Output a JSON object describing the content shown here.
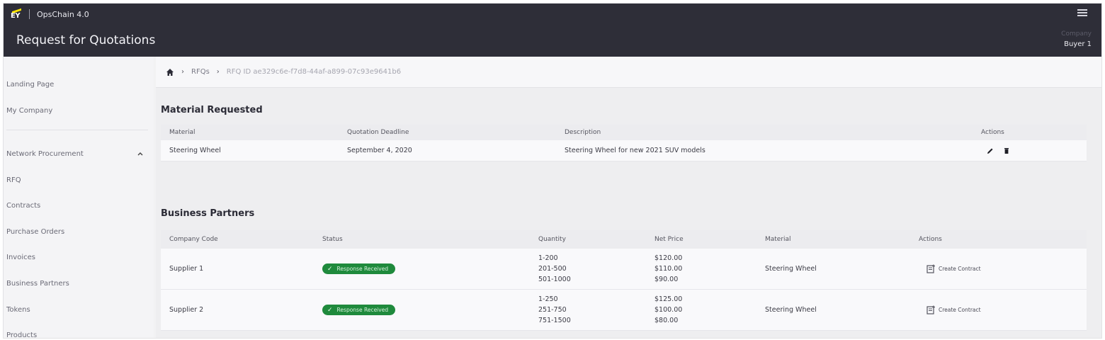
{
  "header": {
    "logo_text": "EY",
    "app_name": "OpsChain 4.0",
    "page_title": "Request for Quotations",
    "company_label": "Company",
    "company_value": "Buyer 1"
  },
  "sidebar": {
    "items": [
      {
        "label": "Landing Page"
      },
      {
        "label": "My Company"
      },
      {
        "label": "Network Procurement"
      },
      {
        "label": "RFQ"
      },
      {
        "label": "Contracts"
      },
      {
        "label": "Purchase Orders"
      },
      {
        "label": "Invoices"
      },
      {
        "label": "Business Partners"
      },
      {
        "label": "Tokens"
      },
      {
        "label": "Products"
      }
    ]
  },
  "breadcrumb": {
    "home_icon": "home-icon",
    "items": [
      "RFQs",
      "RFQ ID ae329c6e-f7d8-44af-a899-07c93e9641b6"
    ]
  },
  "material_section": {
    "title": "Material Requested",
    "headers": [
      "Material",
      "Quotation Deadline",
      "Description",
      "Actions"
    ],
    "rows": [
      {
        "material": "Steering Wheel",
        "deadline": "September 4, 2020",
        "description": "Steering Wheel for new 2021 SUV models",
        "actions": [
          "edit-icon",
          "delete-icon"
        ]
      }
    ]
  },
  "partners_section": {
    "title": "Business Partners",
    "headers": [
      "Company Code",
      "Status",
      "Quantity",
      "Net Price",
      "Material",
      "Actions"
    ],
    "rows": [
      {
        "company": "Supplier 1",
        "status": "Response Received",
        "quantities": [
          "1-200",
          "201-500",
          "501-1000"
        ],
        "prices": [
          "$120.00",
          "$110.00",
          "$90.00"
        ],
        "material": "Steering Wheel",
        "action": "Create Contract"
      },
      {
        "company": "Supplier 2",
        "status": "Response Received",
        "quantities": [
          "1-250",
          "251-750",
          "751-1500"
        ],
        "prices": [
          "$125.00",
          "$100.00",
          "$80.00"
        ],
        "material": "Steering Wheel",
        "action": "Create Contract"
      }
    ]
  },
  "colors": {
    "topbar": "#2e2e38",
    "accent_yellow": "#ffe600",
    "badge_green": "#1f8a3c"
  }
}
